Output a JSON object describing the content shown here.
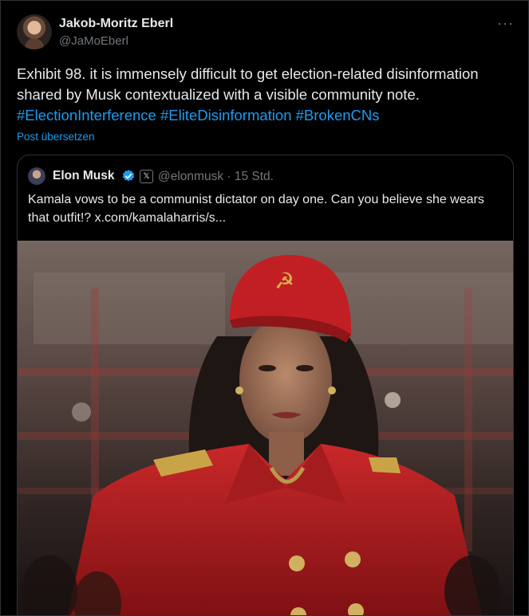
{
  "tweet": {
    "author_name": "Jakob-Moritz Eberl",
    "author_handle": "@JaMoEberl",
    "more_label": "···",
    "text": "Exhibit 98.  it is immensely difficult to get election-related disinformation shared by Musk contextualized with a visible community note.",
    "hashtags": "#ElectionInterference #EliteDisinformation #BrokenCNs",
    "translate_label": "Post übersetzen"
  },
  "quoted": {
    "author_name": "Elon Musk",
    "x_badge": "𝕏",
    "meta": "@elonmusk · 15 Std.",
    "text": "Kamala vows to be a communist dictator on day one. Can you believe she wears that outfit!?  x.com/kamalaharris/s...",
    "verified_color": "#1d9bf0",
    "image": "photo"
  },
  "colors": {
    "background": "#000000",
    "text": "#e7e9ea",
    "muted": "#71767b",
    "link": "#1d9bf0",
    "border": "#2f3336"
  }
}
